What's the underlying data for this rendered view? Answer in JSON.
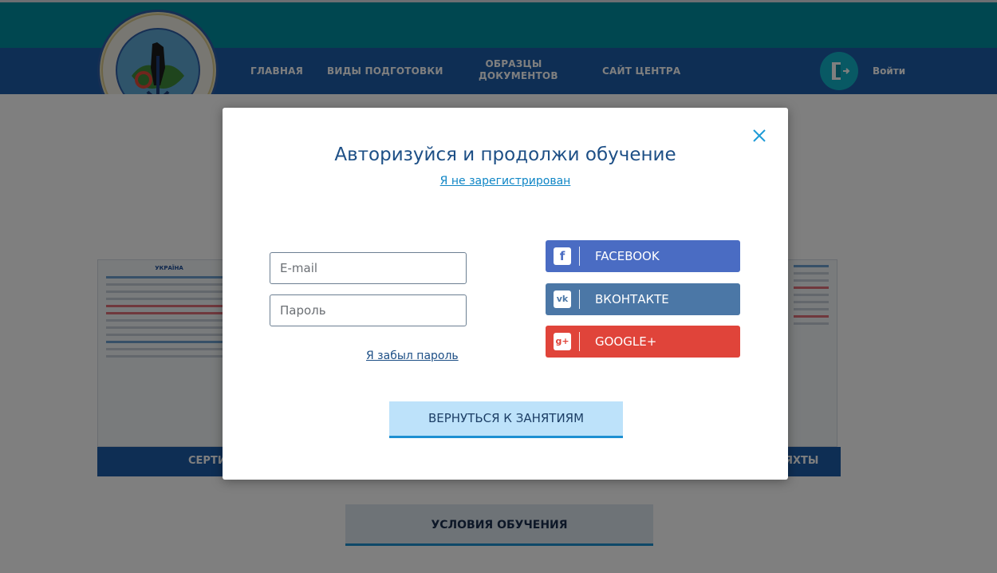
{
  "nav": {
    "home": "ГЛАВНАЯ",
    "training_types": "ВИДЫ ПОДГОТОВКИ",
    "samples_line1": "ОБРАЗЦЫ",
    "samples_line2": "ДОКУМЕНТОВ",
    "center_site": "САЙТ ЦЕНТРА",
    "login": "Войти"
  },
  "background": {
    "cert_bar_left": "СЕРТИ",
    "cert_bar_right": "ЯХТЫ",
    "conditions_button": "УСЛОВИЯ ОБУЧЕНИЯ",
    "cert_heading": "УКРАЇНА"
  },
  "modal": {
    "title": "Авторизуйся и продолжи обучение",
    "register_link": "Я не зарегистрирован",
    "email_placeholder": "E-mail",
    "password_placeholder": "Пароль",
    "forgot_link": "Я забыл пароль",
    "social": {
      "facebook": "FACEBOOK",
      "vkontakte": "ВКОНТАКТЕ",
      "google": "GOOGLE+"
    },
    "back_button": "ВЕРНУТЬСЯ К ЗАНЯТИЯМ"
  },
  "colors": {
    "nav_blue": "#1d5da8",
    "top_teal": "#018fa0",
    "facebook": "#4a6cc3",
    "vkontakte": "#4b77a6",
    "google": "#e0443a",
    "accent": "#1e90d2"
  }
}
